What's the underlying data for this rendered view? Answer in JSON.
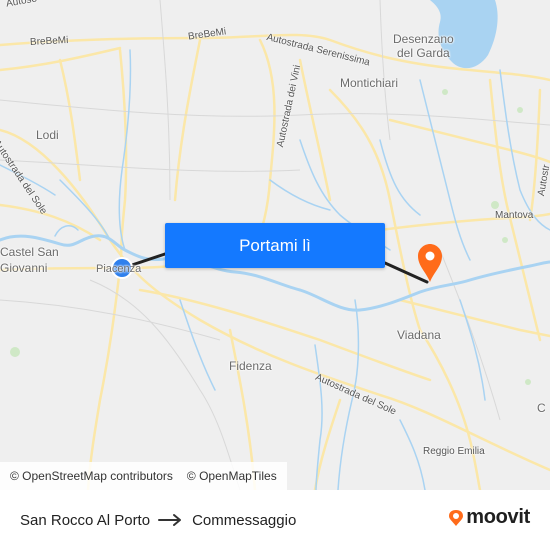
{
  "map": {
    "places": {
      "desenzano": "Desenzano\ndel Garda",
      "montichiari": "Montichiari",
      "lodi": "Lodi",
      "castel_san_giovanni": "Castel San\nGiovanni",
      "piacenza": "Piacenza",
      "mantova": "Mantova",
      "viadana": "Viadana",
      "fidenza": "Fidenza",
      "reggio_emilia": "Reggio Emilia",
      "cap_c": "C"
    },
    "roads": {
      "brebemi_1": "BreBeMi",
      "brebemi_2": "BreBeMi",
      "serenissima": "Autostrada Serenissima",
      "vini": "Autostrada dei Vini",
      "sole_1": "Autostrada del Sole",
      "sole_2": "Autostrada del Sole",
      "autosole_top": "Autoso",
      "autostrada_right": "Autostr"
    },
    "cta_label": "Portami lì",
    "colors": {
      "water": "#a9d3f2",
      "road": "#fbe7a8",
      "route": "#222222",
      "origin": "#2f80ed",
      "destination": "#ff6b1a",
      "cta": "#1479ff"
    }
  },
  "attribution": {
    "osm": "© OpenStreetMap contributors",
    "omt": "© OpenMapTiles"
  },
  "footer": {
    "from": "San Rocco Al Porto",
    "to": "Commessaggio",
    "brand": "moovit"
  }
}
